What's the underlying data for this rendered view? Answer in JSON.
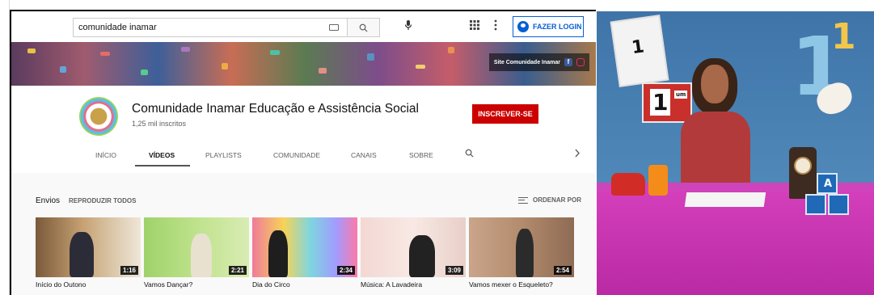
{
  "search": {
    "query": "comunidade inamar"
  },
  "header": {
    "login_label": "FAZER LOGIN"
  },
  "banner": {
    "site_link": "Site Comunidade Inamar"
  },
  "channel": {
    "name": "Comunidade Inamar Educação e Assistência Social",
    "subscribers": "1,25 mil inscritos",
    "subscribe_label": "INSCREVER-SE"
  },
  "tabs": {
    "items": [
      {
        "label": "INÍCIO"
      },
      {
        "label": "VÍDEOS"
      },
      {
        "label": "PLAYLISTS"
      },
      {
        "label": "COMUNIDADE"
      },
      {
        "label": "CANAIS"
      },
      {
        "label": "SOBRE"
      }
    ]
  },
  "uploads": {
    "title": "Envios",
    "play_all": "REPRODUZIR TODOS",
    "sort": "ORDENAR POR",
    "videos": [
      {
        "title": "Início do Outono",
        "duration": "1:16"
      },
      {
        "title": "Vamos Dançar?",
        "duration": "2:21"
      },
      {
        "title": "Dia do Circo",
        "duration": "2:34"
      },
      {
        "title": "Música: A Lavadeira",
        "duration": "3:09"
      },
      {
        "title": "Vamos mexer o Esqueleto?",
        "duration": "2:54"
      }
    ]
  },
  "video_frame": {
    "calendar_number": "1",
    "calendar_small_number": "1",
    "calendar_word": "um",
    "block_letter": "A"
  },
  "colors": {
    "subscribe": "#cc0000",
    "login_accent": "#065fd4",
    "tablecloth": "#c837b3",
    "wall": "#4a80b3"
  }
}
